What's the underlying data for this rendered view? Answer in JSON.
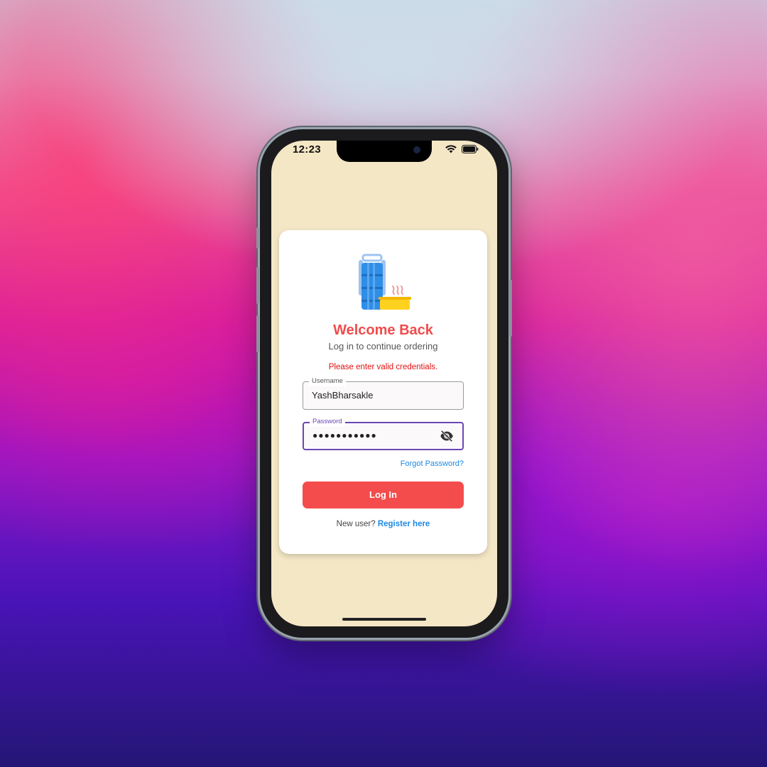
{
  "status_bar": {
    "time": "12:23",
    "wifi_icon": "wifi-icon",
    "battery_icon": "battery-icon"
  },
  "login_card": {
    "logo_icon": "tiffin-box-icon",
    "title": "Welcome Back",
    "subtitle": "Log in to continue ordering",
    "error_message": "Please enter valid credentials.",
    "username": {
      "label": "Username",
      "value": "YashBharsakle"
    },
    "password": {
      "label": "Password",
      "masked_value": "●●●●●●●●●●●",
      "toggle_icon": "eye-off-icon"
    },
    "forgot_password": "Forgot Password?",
    "login_button": "Log In",
    "register_prompt": "New user?",
    "register_link": "Register here"
  },
  "colors": {
    "accent": "#f44c4c",
    "link": "#1e88e5",
    "error": "#e01010",
    "focus": "#6a46b4",
    "screen_background": "#f4e7c6"
  }
}
